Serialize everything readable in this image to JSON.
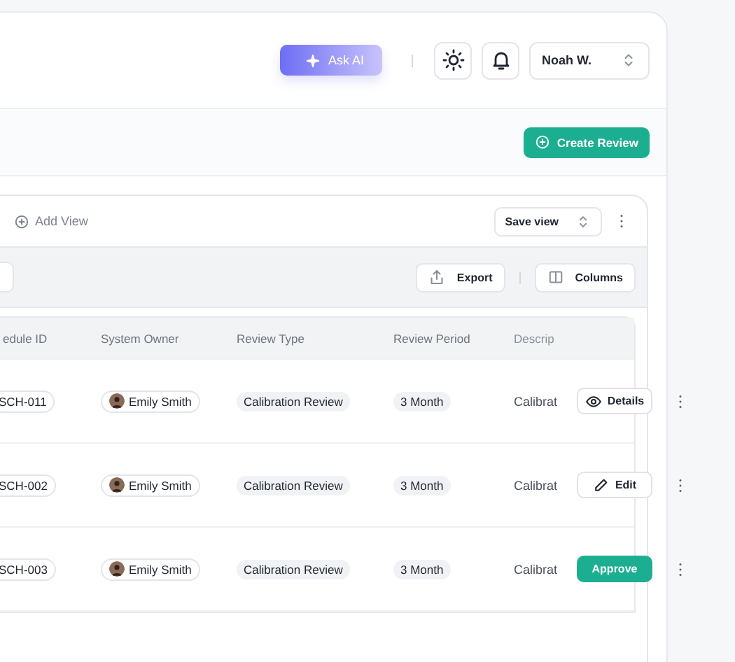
{
  "header": {
    "ask_ai": "Ask AI",
    "user": "Noah W."
  },
  "subheader": {
    "create_button": "Create Review"
  },
  "views": {
    "add_view": "Add View",
    "save_view": "Save view"
  },
  "toolbar": {
    "export": "Export",
    "columns": "Columns"
  },
  "table": {
    "columns": [
      "edule ID",
      "System Owner",
      "Review Type",
      "Review Period",
      "Descrip"
    ],
    "rows": [
      {
        "id": "SCH-011",
        "owner": "Emily Smith",
        "type": "Calibration Review",
        "period": "3 Month",
        "description": "Calibrat",
        "action": {
          "kind": "details",
          "label": "Details"
        }
      },
      {
        "id": "SCH-002",
        "owner": "Emily Smith",
        "type": "Calibration Review",
        "period": "3 Month",
        "description": "Calibrat",
        "action": {
          "kind": "edit",
          "label": "Edit"
        }
      },
      {
        "id": "SCH-003",
        "owner": "Emily Smith",
        "type": "Calibration Review",
        "period": "3 Month",
        "description": "Calibrat",
        "action": {
          "kind": "approve",
          "label": "Approve"
        }
      }
    ]
  }
}
